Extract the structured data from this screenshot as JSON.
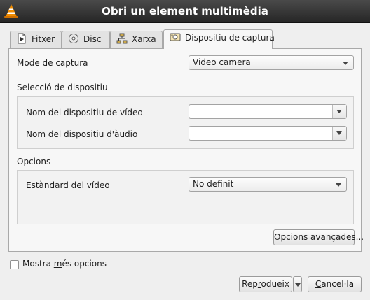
{
  "window": {
    "title": "Obri un element multimèdia"
  },
  "tabs": [
    {
      "prefix": "",
      "mnemonic": "F",
      "rest": "itxer",
      "icon": "file-icon"
    },
    {
      "prefix": "",
      "mnemonic": "D",
      "rest": "isc",
      "icon": "disc-icon"
    },
    {
      "prefix": "",
      "mnemonic": "X",
      "rest": "arxa",
      "icon": "network-icon"
    },
    {
      "prefix": "",
      "mnemonic": "",
      "rest": "Dispositiu de captura",
      "icon": "capture-device-icon"
    }
  ],
  "capture": {
    "mode_label": "Mode de captura",
    "mode_value": "Video camera"
  },
  "device_selection": {
    "heading": "Selecció de dispositiu",
    "video_label": "Nom del dispositiu de vídeo",
    "video_value": "",
    "audio_label": "Nom del dispositiu d'àudio",
    "audio_value": ""
  },
  "options": {
    "heading": "Opcions",
    "standard_label": "Estàndard del vídeo",
    "standard_value": "No definit",
    "advanced_button": "Opcions avançades..."
  },
  "footer": {
    "more_prefix": "Mostra ",
    "more_mnemonic": "m",
    "more_rest": "és opcions",
    "play_prefix": "Rep",
    "play_mnemonic": "r",
    "play_rest": "odueix",
    "cancel_mnemonic": "C",
    "cancel_rest": "ancel·la"
  },
  "colors": {
    "titlebar": "#2e2e2e",
    "vlc_orange": "#f08c00"
  }
}
